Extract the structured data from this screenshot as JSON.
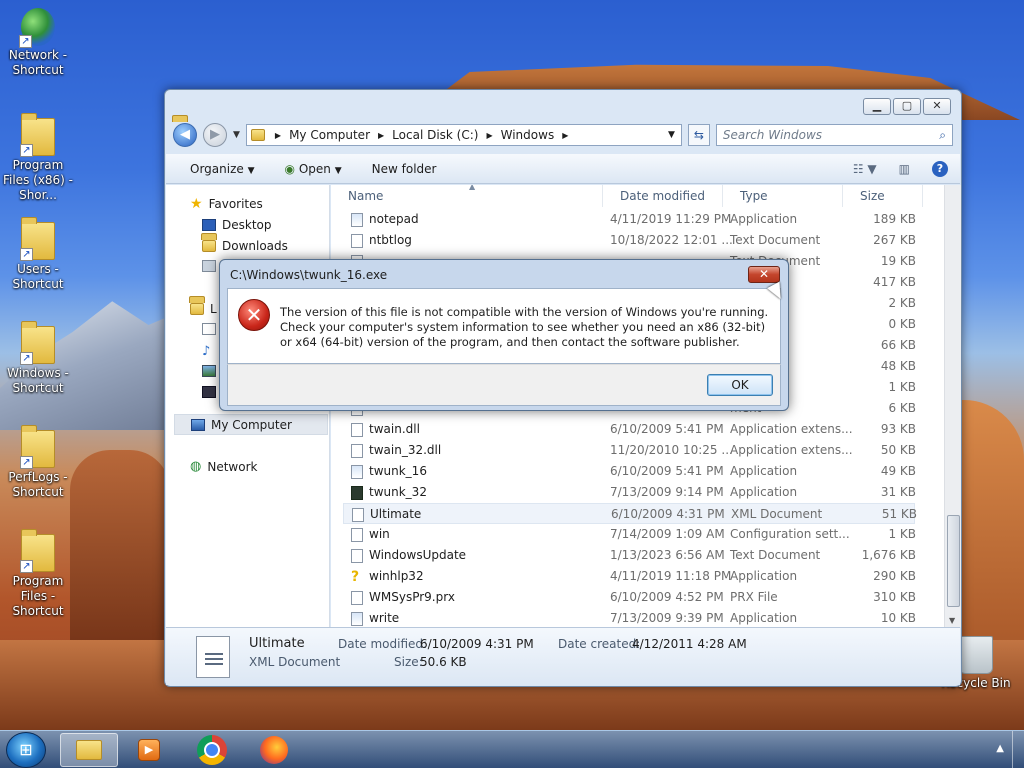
{
  "desktop": {
    "icons": [
      {
        "label": "Network - Shortcut",
        "icon": "network-globe-icon"
      },
      {
        "label": "Program Files (x86) - Shor...",
        "icon": "folder-shortcut-icon"
      },
      {
        "label": "Users - Shortcut",
        "icon": "folder-shortcut-icon"
      },
      {
        "label": "Windows - Shortcut",
        "icon": "folder-shortcut-icon"
      },
      {
        "label": "PerfLogs - Shortcut",
        "icon": "folder-shortcut-icon"
      },
      {
        "label": "Program Files - Shortcut",
        "icon": "folder-shortcut-icon"
      },
      {
        "label": "Recycle Bin",
        "icon": "recycle-bin-icon"
      }
    ]
  },
  "explorer": {
    "address": {
      "crumbs": [
        "My Computer",
        "Local Disk (C:)",
        "Windows"
      ]
    },
    "search_placeholder": "Search Windows",
    "toolbar": {
      "organize": "Organize",
      "open": "Open",
      "new_folder": "New folder"
    },
    "nav": {
      "favorites": "Favorites",
      "desktop": "Desktop",
      "downloads": "Downloads",
      "libraries_initial": "L",
      "my_computer": "My Computer",
      "network": "Network"
    },
    "columns": {
      "name": "Name",
      "date": "Date modified",
      "type": "Type",
      "size": "Size"
    },
    "rows": [
      {
        "name": "notepad",
        "date": "4/11/2019 11:29 PM",
        "type": "Application",
        "size": "189 KB",
        "icon": "app"
      },
      {
        "name": "ntbtlog",
        "date": "10/18/2022 12:01 ...",
        "type": "Text Document",
        "size": "267 KB",
        "icon": "doc"
      },
      {
        "name": "",
        "date": "",
        "type": "Text Document",
        "size": "19 KB",
        "icon": "doc"
      },
      {
        "name": "",
        "date": "",
        "type": "",
        "size": "417 KB",
        "icon": "doc"
      },
      {
        "name": "",
        "date": "",
        "type": "ment",
        "size": "2 KB",
        "icon": "doc"
      },
      {
        "name": "",
        "date": "",
        "type": "ment",
        "size": "0 KB",
        "icon": "doc"
      },
      {
        "name": "",
        "date": "",
        "type": "",
        "size": "66 KB",
        "icon": "doc"
      },
      {
        "name": "",
        "date": "",
        "type": "ment",
        "size": "48 KB",
        "icon": "doc"
      },
      {
        "name": "",
        "date": "",
        "type": "ion sett...",
        "size": "1 KB",
        "icon": "doc"
      },
      {
        "name": "",
        "date": "",
        "type": "ment",
        "size": "6 KB",
        "icon": "doc"
      },
      {
        "name": "twain.dll",
        "date": "6/10/2009 5:41 PM",
        "type": "Application extens...",
        "size": "93 KB",
        "icon": "doc"
      },
      {
        "name": "twain_32.dll",
        "date": "11/20/2010 10:25 ...",
        "type": "Application extens...",
        "size": "50 KB",
        "icon": "doc"
      },
      {
        "name": "twunk_16",
        "date": "6/10/2009 5:41 PM",
        "type": "Application",
        "size": "49 KB",
        "icon": "app"
      },
      {
        "name": "twunk_32",
        "date": "7/13/2009 9:14 PM",
        "type": "Application",
        "size": "31 KB",
        "icon": "dark"
      },
      {
        "name": "Ultimate",
        "date": "6/10/2009 4:31 PM",
        "type": "XML Document",
        "size": "51 KB",
        "icon": "doc",
        "selected": true
      },
      {
        "name": "win",
        "date": "7/14/2009 1:09 AM",
        "type": "Configuration sett...",
        "size": "1 KB",
        "icon": "doc"
      },
      {
        "name": "WindowsUpdate",
        "date": "1/13/2023 6:56 AM",
        "type": "Text Document",
        "size": "1,676 KB",
        "icon": "doc"
      },
      {
        "name": "winhlp32",
        "date": "4/11/2019 11:18 PM",
        "type": "Application",
        "size": "290 KB",
        "icon": "help"
      },
      {
        "name": "WMSysPr9.prx",
        "date": "6/10/2009 4:52 PM",
        "type": "PRX File",
        "size": "310 KB",
        "icon": "doc"
      },
      {
        "name": "write",
        "date": "7/13/2009 9:39 PM",
        "type": "Application",
        "size": "10 KB",
        "icon": "app"
      }
    ],
    "details": {
      "name": "Ultimate",
      "type": "XML Document",
      "modified_label": "Date modified:",
      "modified_value": "6/10/2009 4:31 PM",
      "created_label": "Date created:",
      "created_value": "4/12/2011 4:28 AM",
      "size_label": "Size:",
      "size_value": "50.6 KB"
    }
  },
  "dialog": {
    "title": "C:\\Windows\\twunk_16.exe",
    "message": "The version of this file is not compatible with the version of Windows you're running. Check your computer's system information to see whether you need an x86 (32-bit) or x64 (64-bit) version of the program, and then contact the software publisher.",
    "ok": "OK"
  }
}
